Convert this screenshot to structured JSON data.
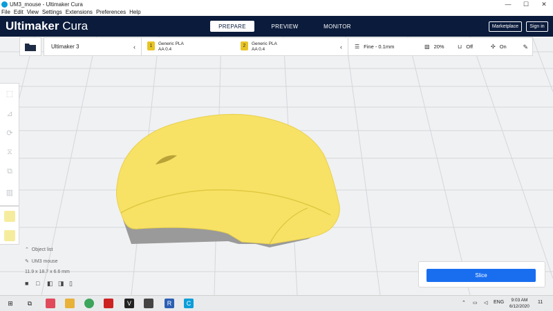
{
  "window": {
    "title": "UM3_mouse - Ultimaker Cura",
    "buttons": [
      "—",
      "☐",
      "✕"
    ]
  },
  "menu": [
    "File",
    "Edit",
    "View",
    "Settings",
    "Extensions",
    "Preferences",
    "Help"
  ],
  "header": {
    "brand_bold": "Ultimaker",
    "brand_light": " Cura",
    "stages": [
      "PREPARE",
      "PREVIEW",
      "MONITOR"
    ],
    "active_stage": "PREPARE",
    "marketplace": "Marketplace",
    "sign_in": "Sign in"
  },
  "printer": {
    "name": "Ultimaker 3",
    "chevron": "‹"
  },
  "materials": [
    {
      "index": "1",
      "name": "Generic PLA",
      "core": "AA 0.4"
    },
    {
      "index": "2",
      "name": "Generic PLA",
      "core": "AA 0.4"
    }
  ],
  "print_settings": {
    "profile": "Fine - 0.1mm",
    "infill": "20%",
    "support": "Off",
    "adhesion": "On"
  },
  "object_list": {
    "toggle": "Object list",
    "object_name": "UM3 mouse",
    "dimensions": "11.9 x 18.7 x 6.6 mm"
  },
  "slice": {
    "label": "Slice"
  },
  "taskbar": {
    "lang": "ENG",
    "time": "9:03 AM",
    "date": "6/12/2020",
    "notif": "11"
  },
  "colors": {
    "header": "#0b1b3c",
    "accent": "#196ef0",
    "model": "#f7e266",
    "material_badge": "#e8c424"
  },
  "icons": [
    "open-folder-icon",
    "move-icon",
    "scale-icon",
    "rotate-icon",
    "mirror-icon",
    "per-model-settings-icon",
    "support-blocker-icon",
    "windows-start-icon",
    "search-icon",
    "chrome-icon"
  ]
}
